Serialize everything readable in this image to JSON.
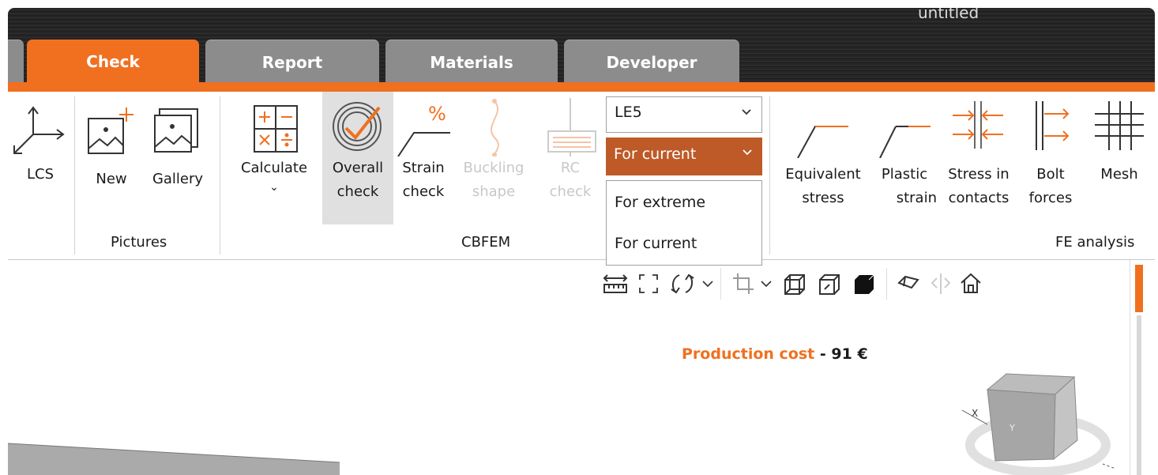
{
  "window": {
    "title": "untitled"
  },
  "tabs": [
    {
      "label": "Check",
      "active": true
    },
    {
      "label": "Report",
      "active": false
    },
    {
      "label": "Materials",
      "active": false
    },
    {
      "label": "Developer",
      "active": false
    }
  ],
  "ribbon": {
    "lcs": {
      "label": "LCS"
    },
    "pictures": {
      "new": "New",
      "gallery": "Gallery",
      "group_label": "Pictures"
    },
    "cbfem": {
      "calculate": "Calculate",
      "overall_check": [
        "Overall",
        "check"
      ],
      "strain_check": [
        "Strain",
        "check"
      ],
      "buckling_shape": [
        "Buckling",
        "shape"
      ],
      "rc_check": [
        "RC",
        "check"
      ],
      "group_label": "CBFEM"
    },
    "load_case_dropdown": {
      "value": "LE5"
    },
    "mode_dropdown": {
      "value": "For current"
    },
    "mode_options": [
      "For extreme",
      "For current"
    ],
    "fe_analysis": {
      "equivalent_stress": [
        "Equivalent",
        "stress"
      ],
      "plastic_strain": [
        "Plastic",
        "strain"
      ],
      "stress_in_contacts": [
        "Stress in",
        "contacts"
      ],
      "bolt_forces": [
        "Bolt",
        "forces"
      ],
      "mesh": "Mesh",
      "group_label": "FE analysis"
    }
  },
  "viewport": {
    "production_cost_label": "Production cost",
    "production_cost_sep": "-",
    "production_cost_value": "91 €",
    "nav_cube_axes": [
      "X",
      "Y"
    ]
  },
  "colors": {
    "accent": "#f07020",
    "dropdown_selected": "#bd5a28",
    "disabled": "#c8c8c8"
  },
  "icons": [
    "lcs-icon",
    "new-picture-icon",
    "gallery-icon",
    "calculate-icon",
    "overall-check-icon",
    "strain-check-icon",
    "buckling-shape-icon",
    "rc-check-icon",
    "equivalent-stress-icon",
    "plastic-strain-icon",
    "stress-in-contacts-icon",
    "bolt-forces-icon",
    "mesh-icon",
    "measure-icon",
    "fit-icon",
    "rotate-icon",
    "crop-icon",
    "wireframe-cube-icon",
    "transparent-cube-icon",
    "solid-cube-icon",
    "eraser-icon",
    "mirror-icon",
    "home-icon"
  ]
}
